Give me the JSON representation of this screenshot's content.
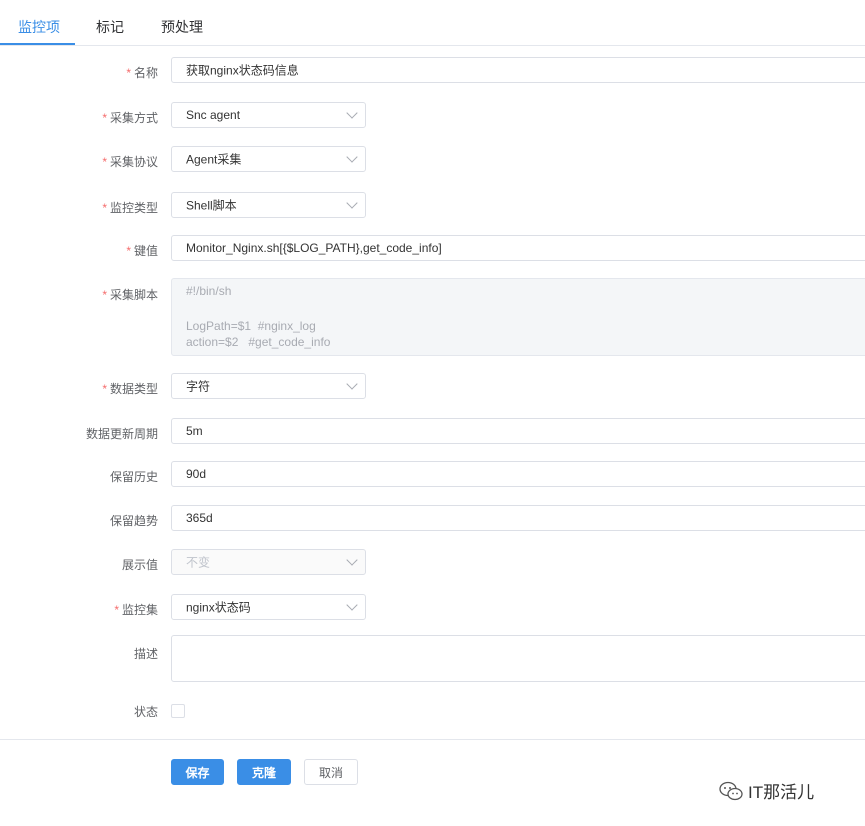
{
  "tabs": [
    {
      "label": "监控项",
      "active": true
    },
    {
      "label": "标记",
      "active": false
    },
    {
      "label": "预处理",
      "active": false
    }
  ],
  "form": {
    "name": {
      "label": "名称",
      "required": true,
      "value": "获取nginx状态码信息"
    },
    "collect_method": {
      "label": "采集方式",
      "required": true,
      "value": "Snc agent"
    },
    "collect_protocol": {
      "label": "采集协议",
      "required": true,
      "value": "Agent采集"
    },
    "monitor_type": {
      "label": "监控类型",
      "required": true,
      "value": "Shell脚本"
    },
    "key": {
      "label": "键值",
      "required": true,
      "value": "Monitor_Nginx.sh[{$LOG_PATH},get_code_info]"
    },
    "script": {
      "label": "采集脚本",
      "required": true,
      "lines": [
        "#!/bin/sh",
        "",
        "LogPath=$1  #nginx_log",
        "action=$2   #get_code_info"
      ]
    },
    "data_type": {
      "label": "数据类型",
      "required": true,
      "value": "字符"
    },
    "update_interval": {
      "label": "数据更新周期",
      "required": false,
      "value": "5m"
    },
    "history": {
      "label": "保留历史",
      "required": false,
      "value": "90d"
    },
    "trend": {
      "label": "保留趋势",
      "required": false,
      "value": "365d"
    },
    "display_value": {
      "label": "展示值",
      "required": false,
      "placeholder": "不变"
    },
    "monitor_set": {
      "label": "监控集",
      "required": true,
      "value": "nginx状态码"
    },
    "description": {
      "label": "描述",
      "required": false,
      "value": ""
    },
    "status": {
      "label": "状态",
      "required": false,
      "checked": false
    }
  },
  "buttons": {
    "save": "保存",
    "clone": "克隆",
    "cancel": "取消"
  },
  "watermark": {
    "text": "IT那活儿"
  },
  "colors": {
    "accent": "#3a8ee6",
    "required": "#f56c6c",
    "border": "#dcdfe6"
  }
}
